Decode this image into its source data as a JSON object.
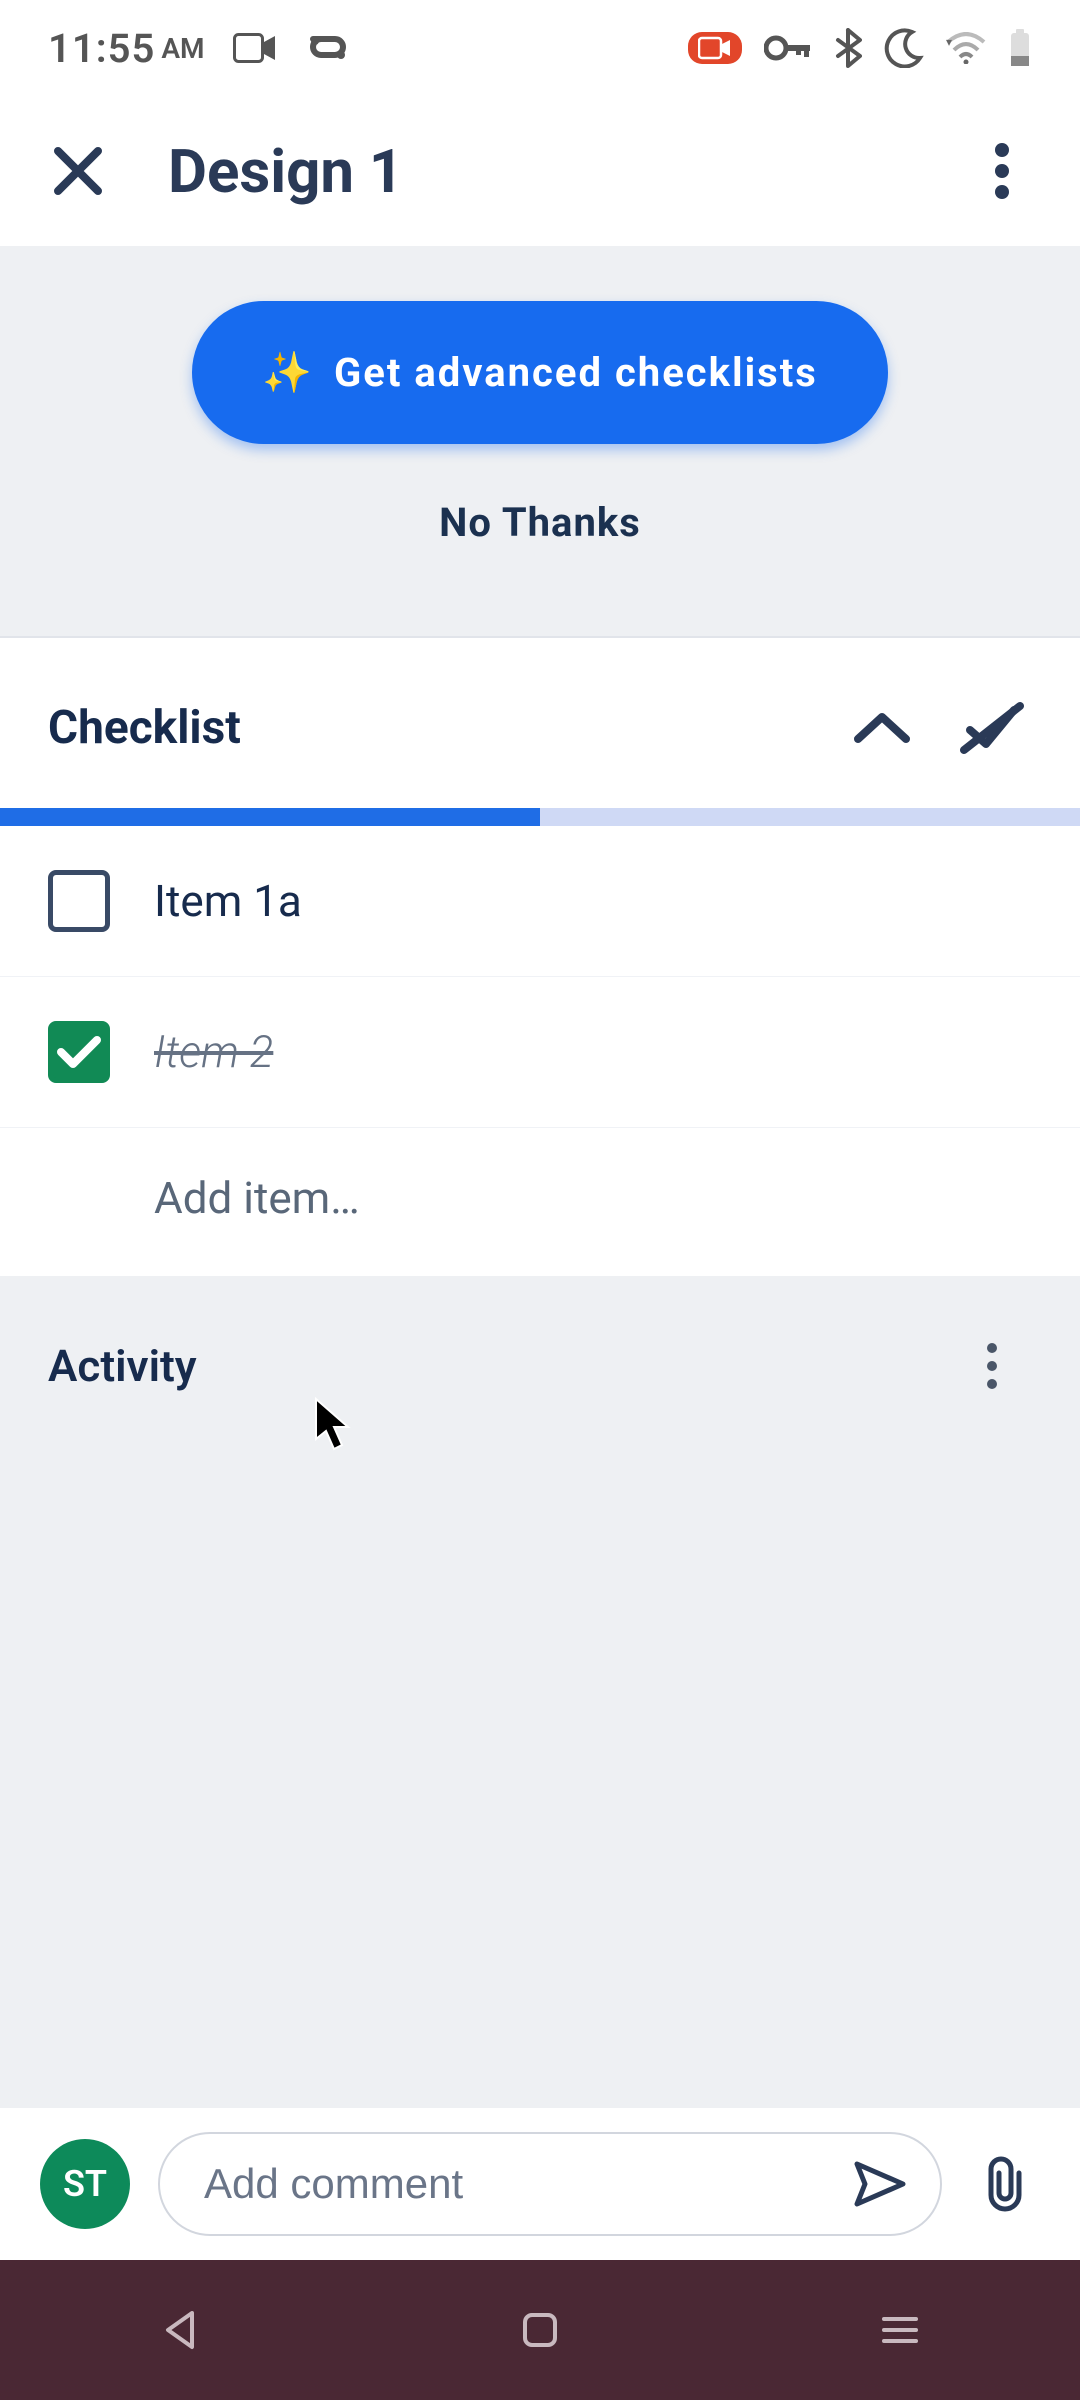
{
  "status_bar": {
    "time": "11:55",
    "ampm": "AM"
  },
  "header": {
    "title": "Design 1"
  },
  "promo": {
    "cta_label": "Get advanced checklists",
    "dismiss_label": "No Thanks"
  },
  "checklist": {
    "title": "Checklist",
    "progress_percent": 50,
    "items": [
      {
        "label": "Item 1a",
        "checked": false
      },
      {
        "label": "Item 2",
        "checked": true
      }
    ],
    "add_placeholder": "Add item…"
  },
  "activity": {
    "title": "Activity"
  },
  "comment": {
    "avatar_initials": "ST",
    "placeholder": "Add comment"
  },
  "colors": {
    "accent": "#176bef",
    "checked_green": "#118a55",
    "nav_bg": "#4a2834"
  }
}
